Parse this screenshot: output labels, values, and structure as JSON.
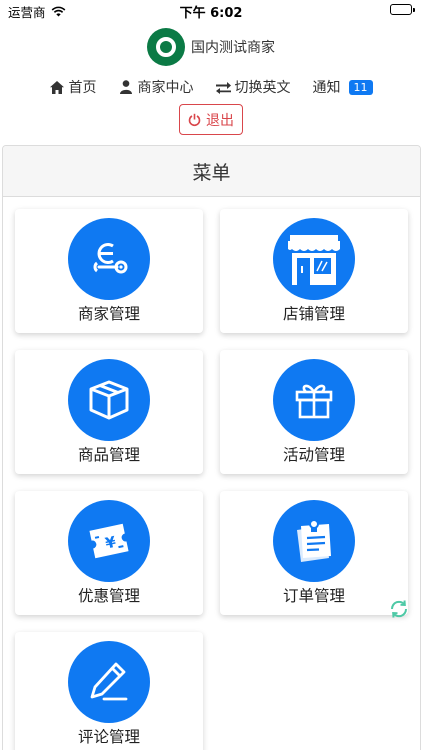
{
  "status_bar": {
    "carrier": "运营商",
    "time": "下午 6:02"
  },
  "header": {
    "brand_name": "国内测试商家"
  },
  "nav": {
    "home": "首页",
    "merchant_center": "商家中心",
    "switch_language": "切换英文",
    "notifications": "通知",
    "notification_count": "11"
  },
  "logout_label": "退出",
  "menu": {
    "title": "菜单",
    "items": [
      {
        "label": "商家管理",
        "icon": "merchant-icon"
      },
      {
        "label": "店铺管理",
        "icon": "store-icon"
      },
      {
        "label": "商品管理",
        "icon": "box-icon"
      },
      {
        "label": "活动管理",
        "icon": "gift-icon"
      },
      {
        "label": "优惠管理",
        "icon": "coupon-icon"
      },
      {
        "label": "订单管理",
        "icon": "order-icon"
      },
      {
        "label": "评论管理",
        "icon": "pencil-icon"
      }
    ]
  },
  "colors": {
    "accent": "#0f79f2",
    "danger": "#d9464b",
    "brand_green": "#0b7a45"
  }
}
